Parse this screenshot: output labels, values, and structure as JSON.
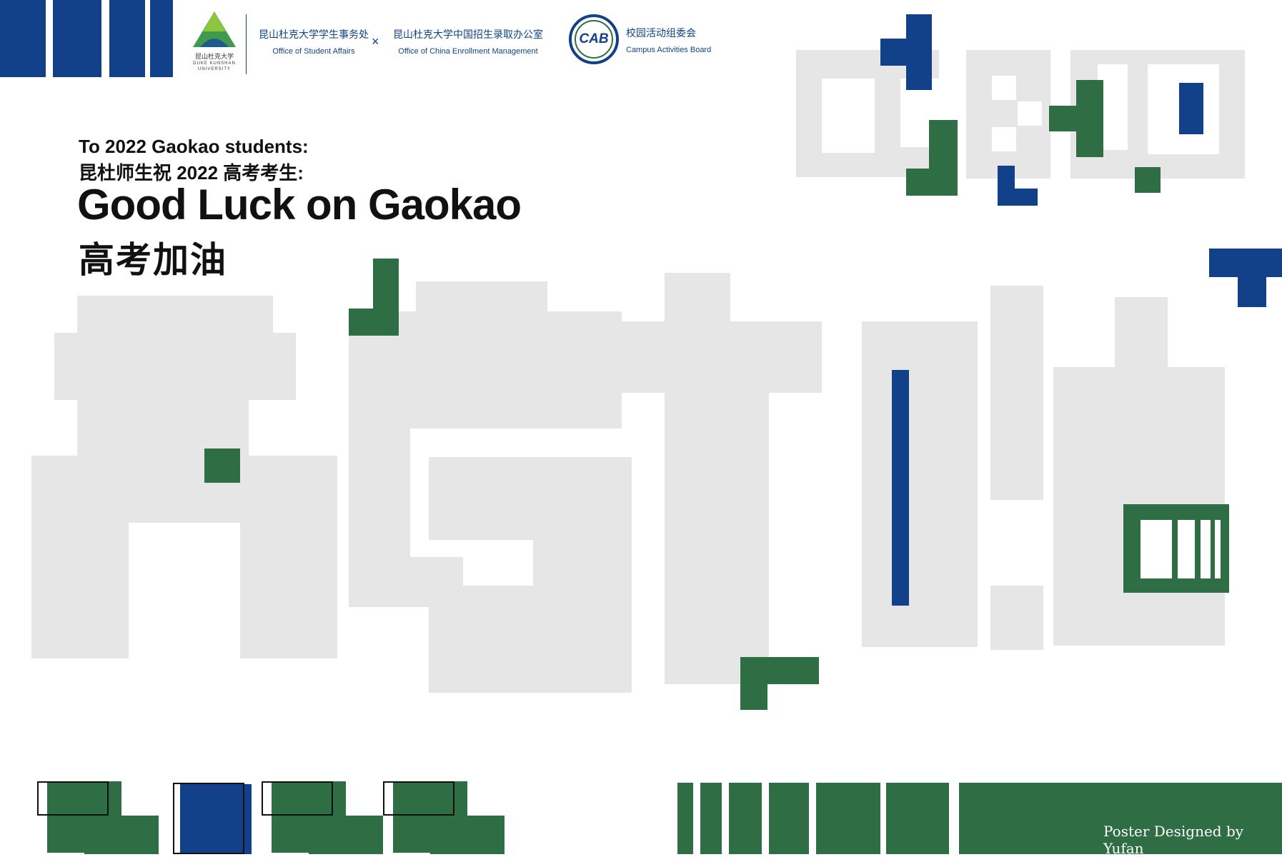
{
  "header": {
    "dku_logo_cn": "昆山杜克大学",
    "dku_logo_en_1": "DUKE KUNSHAN",
    "dku_logo_en_2": "UNIVERSITY",
    "osa_cn": "昆山杜克大学学生事务处",
    "osa_en": "Office of Student Affairs",
    "separator": "×",
    "ocem_cn": "昆山杜克大学中国招生录取办公室",
    "ocem_en": "Office of China Enrollment Management",
    "cab_logo": "CAB",
    "cab_cn": "校园活动组委会",
    "cab_en": "Campus Activities Board"
  },
  "headline": {
    "line1": "To 2022 Gaokao students:",
    "line2": "昆杜师生祝 2022 高考考生:",
    "title_en": "Good Luck on Gaokao",
    "title_cn": "高考加油"
  },
  "footer": {
    "credit": "Poster Designed by Yufan"
  },
  "colors": {
    "blue": "#12418a",
    "green": "#2f6e44",
    "grey": "#e6e6e6"
  }
}
